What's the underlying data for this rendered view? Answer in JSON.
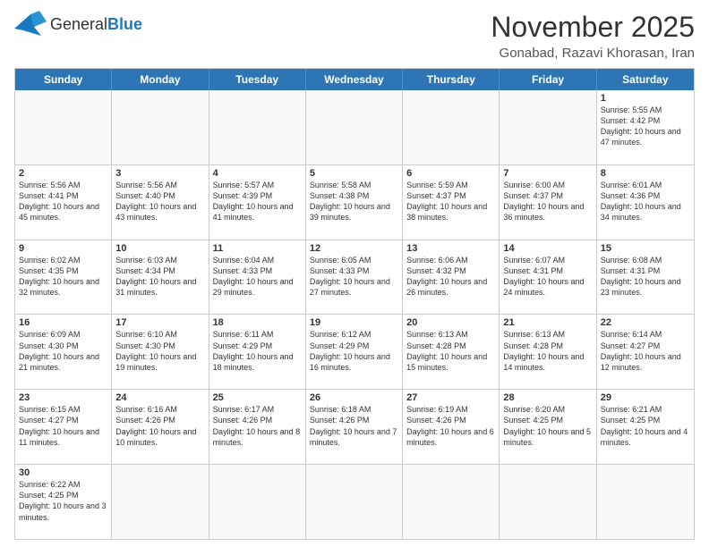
{
  "header": {
    "logo": {
      "general": "General",
      "blue": "Blue"
    },
    "month_year": "November 2025",
    "location": "Gonabad, Razavi Khorasan, Iran"
  },
  "weekdays": [
    "Sunday",
    "Monday",
    "Tuesday",
    "Wednesday",
    "Thursday",
    "Friday",
    "Saturday"
  ],
  "rows": [
    [
      {
        "day": "",
        "info": ""
      },
      {
        "day": "",
        "info": ""
      },
      {
        "day": "",
        "info": ""
      },
      {
        "day": "",
        "info": ""
      },
      {
        "day": "",
        "info": ""
      },
      {
        "day": "",
        "info": ""
      },
      {
        "day": "1",
        "info": "Sunrise: 5:55 AM\nSunset: 4:42 PM\nDaylight: 10 hours and 47 minutes."
      }
    ],
    [
      {
        "day": "2",
        "info": "Sunrise: 5:56 AM\nSunset: 4:41 PM\nDaylight: 10 hours and 45 minutes."
      },
      {
        "day": "3",
        "info": "Sunrise: 5:56 AM\nSunset: 4:40 PM\nDaylight: 10 hours and 43 minutes."
      },
      {
        "day": "4",
        "info": "Sunrise: 5:57 AM\nSunset: 4:39 PM\nDaylight: 10 hours and 41 minutes."
      },
      {
        "day": "5",
        "info": "Sunrise: 5:58 AM\nSunset: 4:38 PM\nDaylight: 10 hours and 39 minutes."
      },
      {
        "day": "6",
        "info": "Sunrise: 5:59 AM\nSunset: 4:37 PM\nDaylight: 10 hours and 38 minutes."
      },
      {
        "day": "7",
        "info": "Sunrise: 6:00 AM\nSunset: 4:37 PM\nDaylight: 10 hours and 36 minutes."
      },
      {
        "day": "8",
        "info": "Sunrise: 6:01 AM\nSunset: 4:36 PM\nDaylight: 10 hours and 34 minutes."
      }
    ],
    [
      {
        "day": "9",
        "info": "Sunrise: 6:02 AM\nSunset: 4:35 PM\nDaylight: 10 hours and 32 minutes."
      },
      {
        "day": "10",
        "info": "Sunrise: 6:03 AM\nSunset: 4:34 PM\nDaylight: 10 hours and 31 minutes."
      },
      {
        "day": "11",
        "info": "Sunrise: 6:04 AM\nSunset: 4:33 PM\nDaylight: 10 hours and 29 minutes."
      },
      {
        "day": "12",
        "info": "Sunrise: 6:05 AM\nSunset: 4:33 PM\nDaylight: 10 hours and 27 minutes."
      },
      {
        "day": "13",
        "info": "Sunrise: 6:06 AM\nSunset: 4:32 PM\nDaylight: 10 hours and 26 minutes."
      },
      {
        "day": "14",
        "info": "Sunrise: 6:07 AM\nSunset: 4:31 PM\nDaylight: 10 hours and 24 minutes."
      },
      {
        "day": "15",
        "info": "Sunrise: 6:08 AM\nSunset: 4:31 PM\nDaylight: 10 hours and 23 minutes."
      }
    ],
    [
      {
        "day": "16",
        "info": "Sunrise: 6:09 AM\nSunset: 4:30 PM\nDaylight: 10 hours and 21 minutes."
      },
      {
        "day": "17",
        "info": "Sunrise: 6:10 AM\nSunset: 4:30 PM\nDaylight: 10 hours and 19 minutes."
      },
      {
        "day": "18",
        "info": "Sunrise: 6:11 AM\nSunset: 4:29 PM\nDaylight: 10 hours and 18 minutes."
      },
      {
        "day": "19",
        "info": "Sunrise: 6:12 AM\nSunset: 4:29 PM\nDaylight: 10 hours and 16 minutes."
      },
      {
        "day": "20",
        "info": "Sunrise: 6:13 AM\nSunset: 4:28 PM\nDaylight: 10 hours and 15 minutes."
      },
      {
        "day": "21",
        "info": "Sunrise: 6:13 AM\nSunset: 4:28 PM\nDaylight: 10 hours and 14 minutes."
      },
      {
        "day": "22",
        "info": "Sunrise: 6:14 AM\nSunset: 4:27 PM\nDaylight: 10 hours and 12 minutes."
      }
    ],
    [
      {
        "day": "23",
        "info": "Sunrise: 6:15 AM\nSunset: 4:27 PM\nDaylight: 10 hours and 11 minutes."
      },
      {
        "day": "24",
        "info": "Sunrise: 6:16 AM\nSunset: 4:26 PM\nDaylight: 10 hours and 10 minutes."
      },
      {
        "day": "25",
        "info": "Sunrise: 6:17 AM\nSunset: 4:26 PM\nDaylight: 10 hours and 8 minutes."
      },
      {
        "day": "26",
        "info": "Sunrise: 6:18 AM\nSunset: 4:26 PM\nDaylight: 10 hours and 7 minutes."
      },
      {
        "day": "27",
        "info": "Sunrise: 6:19 AM\nSunset: 4:26 PM\nDaylight: 10 hours and 6 minutes."
      },
      {
        "day": "28",
        "info": "Sunrise: 6:20 AM\nSunset: 4:25 PM\nDaylight: 10 hours and 5 minutes."
      },
      {
        "day": "29",
        "info": "Sunrise: 6:21 AM\nSunset: 4:25 PM\nDaylight: 10 hours and 4 minutes."
      }
    ],
    [
      {
        "day": "30",
        "info": "Sunrise: 6:22 AM\nSunset: 4:25 PM\nDaylight: 10 hours and 3 minutes."
      },
      {
        "day": "",
        "info": ""
      },
      {
        "day": "",
        "info": ""
      },
      {
        "day": "",
        "info": ""
      },
      {
        "day": "",
        "info": ""
      },
      {
        "day": "",
        "info": ""
      },
      {
        "day": "",
        "info": ""
      }
    ]
  ]
}
